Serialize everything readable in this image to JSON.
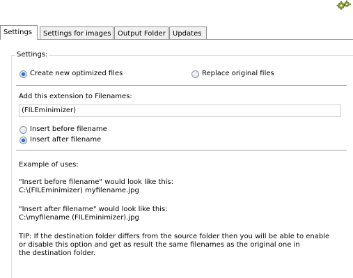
{
  "tabs": [
    {
      "label": "Settings",
      "active": true
    },
    {
      "label": "Settings for images",
      "active": false
    },
    {
      "label": "Output Folder",
      "active": false
    },
    {
      "label": "Updates",
      "active": false
    }
  ],
  "group": {
    "title": "Settings:"
  },
  "mode": {
    "create_label": "Create new optimized files",
    "replace_label": "Replace original files",
    "selected": "create"
  },
  "extension": {
    "label": "Add this extension to Filenames:",
    "value": "(FILEminimizer)"
  },
  "position": {
    "before_label": "Insert before filename",
    "after_label": "Insert after filename",
    "selected": "after"
  },
  "examples": {
    "heading": "Example of uses:",
    "before_line1": "\"Insert before filename\" would look like this:",
    "before_line2": "C:\\(FILEminimizer) myfilename.jpg",
    "after_line1": "\"Insert after filename\" would look like this:",
    "after_line2": "C:\\myfilename (FILEminimizer).jpg",
    "tip_line1": "TIP: If the destination folder differs from the source folder then you will be able to enable",
    "tip_line2": "or disable this option and get as result the same filenames as the original one in",
    "tip_line3": "the destination folder."
  },
  "colors": {
    "radio_selected": "#2a6ed6",
    "gear": "#6b8e23"
  },
  "icons": {
    "top_right": "gear-icon"
  }
}
